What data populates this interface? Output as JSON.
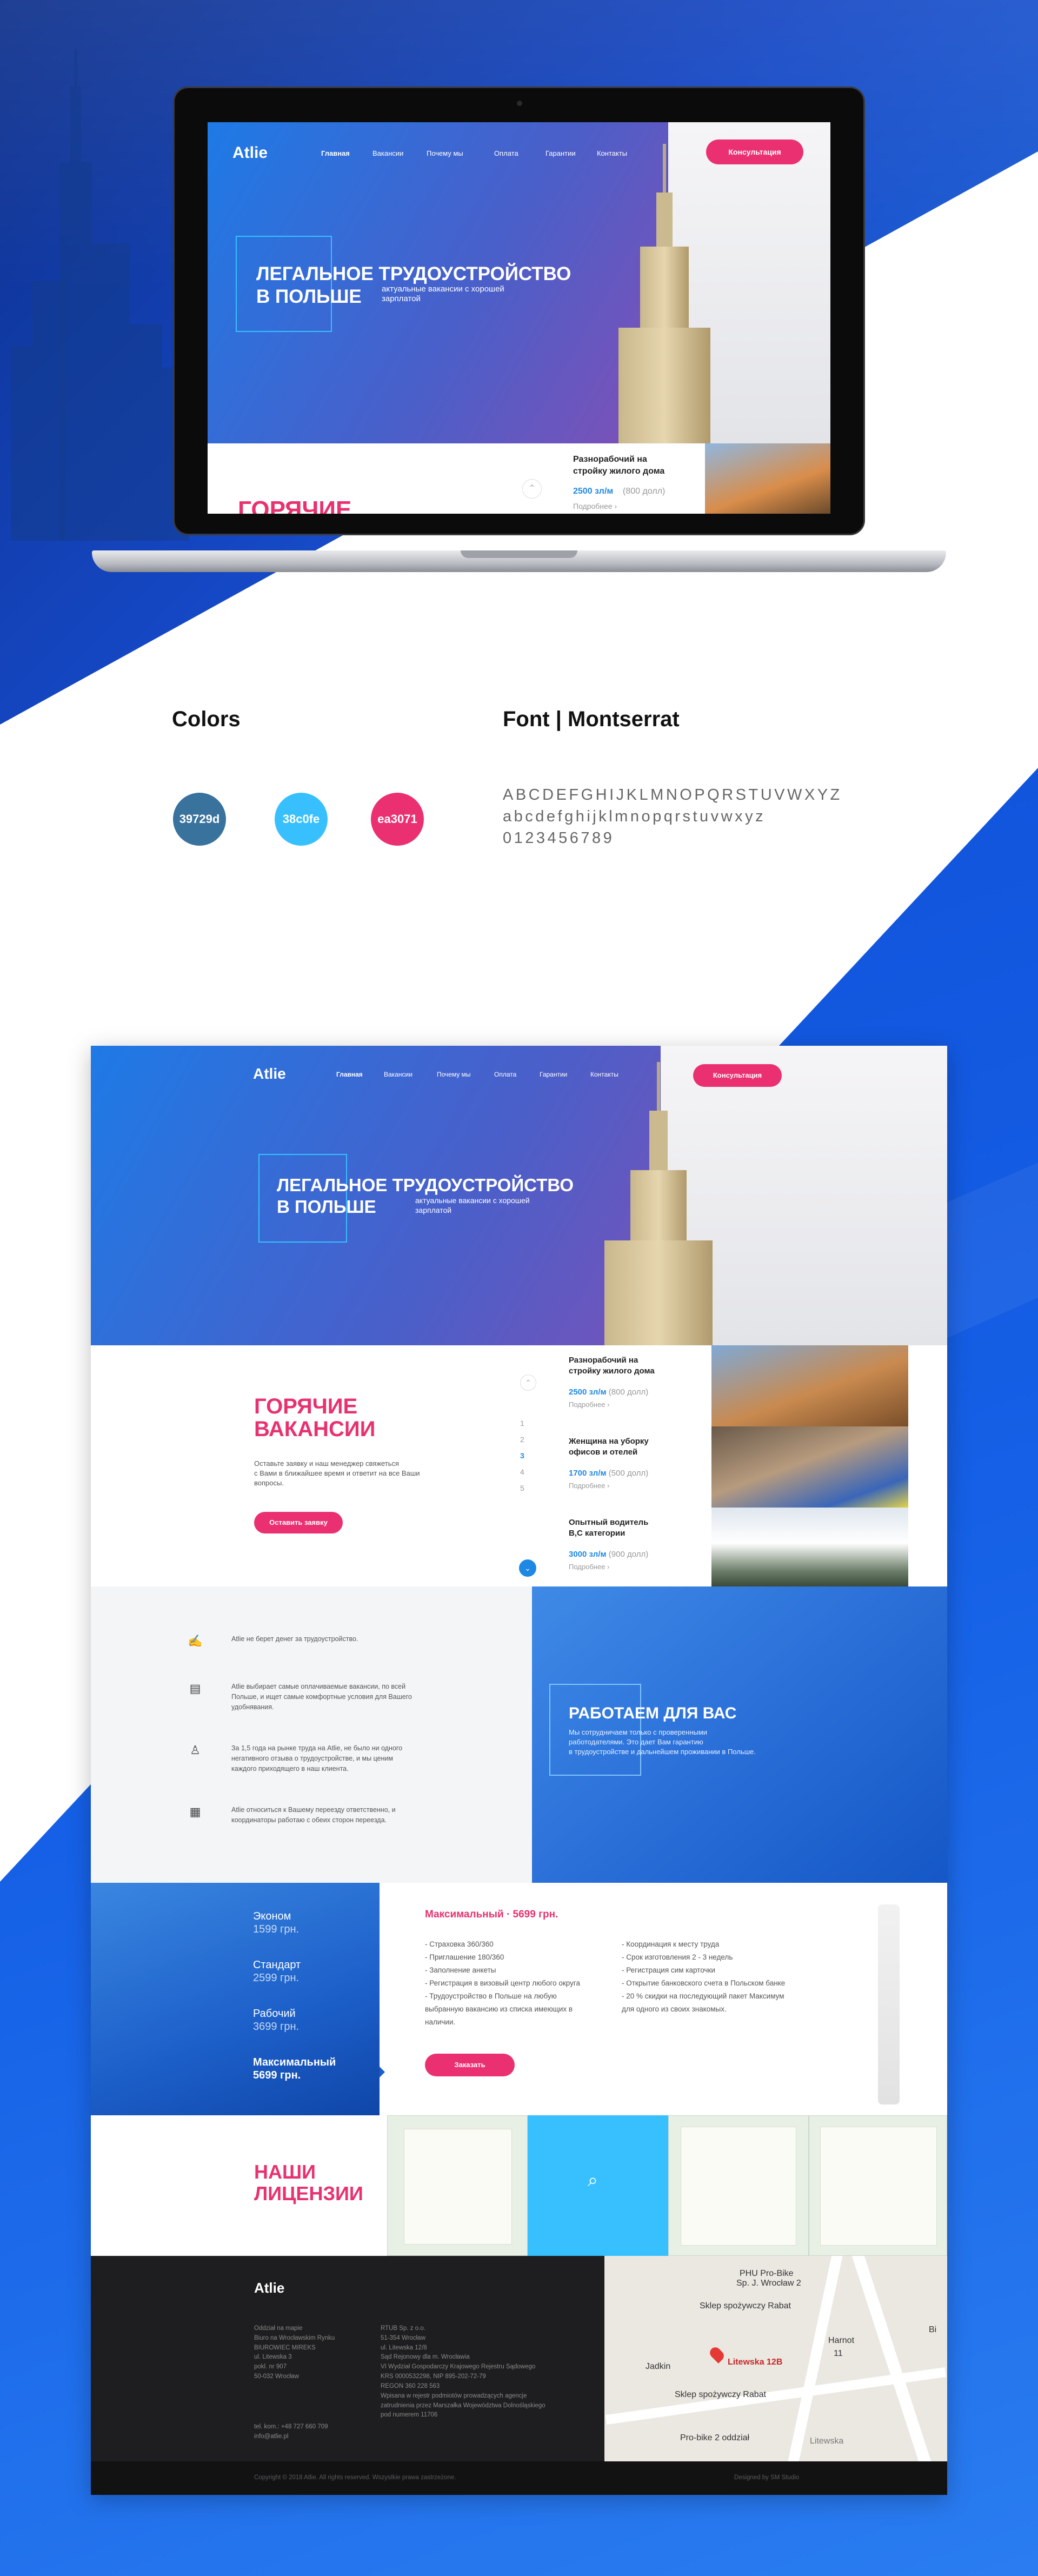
{
  "colors": {
    "primary": "#39729d",
    "accent": "#38c0fe",
    "pink": "#ea3071"
  },
  "site": {
    "logo": "Atlie",
    "nav": [
      "Главная",
      "Вакансии",
      "Почему мы",
      "Оплата",
      "Гарантии",
      "Контакты"
    ],
    "consult_btn": "Консультация",
    "hero_title_1": "ЛЕГАЛЬНОЕ ТРУДОУСТРОЙСТВО",
    "hero_title_2": "В ПОЛЬШЕ",
    "hero_sub_1": "актуальные вакансии с хорошей",
    "hero_sub_2": "зарплатой"
  },
  "jobs": {
    "title_1": "ГОРЯЧИЕ",
    "title_2": "ВАКАНСИИ",
    "desc_1": "Оставьте заявку и наш менеджер свяжеться",
    "desc_2": "с Вами в ближайшее время и ответит на все Ваши",
    "desc_3": "вопросы.",
    "button": "Оставить заявку",
    "pager": [
      "1",
      "2",
      "3",
      "4",
      "5"
    ],
    "items": [
      {
        "title_1": "Разнорабочий на",
        "title_2": "стройку жилого дома",
        "price": "2500 зл/м",
        "old": "(800 долл)",
        "more": "Подробнее ›"
      },
      {
        "title_1": "Женщина на уборку",
        "title_2": "офисов и отелей",
        "price": "1700 зл/м",
        "old": "(500 долл)",
        "more": "Подробнее ›"
      },
      {
        "title_1": "Опытный водитель",
        "title_2": "B,C категории",
        "price": "3000 зл/м",
        "old": "(900 долл)",
        "more": "Подробнее ›"
      }
    ],
    "laptop_short": "ГОРЯЧИЕ"
  },
  "style_guide": {
    "colors_title": "Colors",
    "font_title": "Font | Montserrat",
    "swatches": [
      "39729d",
      "38c0fe",
      "ea3071"
    ],
    "upper": "ABCDEFGHIJKLMNOPQRSTUVWXYZ",
    "lower": "abcdefghijklmnopqrstuvwxyz",
    "digits": "0123456789"
  },
  "why": {
    "features": [
      {
        "icon": "handshake-icon",
        "line_1": "Atlie не берет денег за трудоустройство."
      },
      {
        "icon": "document-icon",
        "line_1": "Atlie выбирает самые оплачиваемые вакансии, по всей",
        "line_2": "Польше, и ищет самые комфортные условия для Вашего",
        "line_3": "удобнявания."
      },
      {
        "icon": "worker-icon",
        "line_1": "За 1,5 года на рынке труда на Atlie, не было ни одного",
        "line_2": "негативного отзыва о трудоустройстве, и мы ценим",
        "line_3": "каждого приходящего в наш клиента."
      },
      {
        "icon": "contract-icon",
        "line_1": "Atlie относиться к Вашему переезду ответственно, и",
        "line_2": "координаторы работаю с обеих сторон переезда."
      }
    ],
    "title": "РАБОТАЕМ ДЛЯ ВАС",
    "text_1": "Мы сотрудничаем только с проверенными",
    "text_2": "работодателями. Это дает Вам гарантию",
    "text_3": "в трудоустройстве и дальнейшем проживании в Польше."
  },
  "pricing": {
    "plans": [
      {
        "name": "Эконом",
        "price": "1599 грн."
      },
      {
        "name": "Стандарт",
        "price": "2599 грн."
      },
      {
        "name": "Рабочий",
        "price": "3699 грн."
      },
      {
        "name": "Максимальный",
        "price": "5699 грн."
      }
    ],
    "selected_name": "Максимальный",
    "selected_price": "5699 грн.",
    "left_list": [
      "- Страховка 360/360",
      "- Приглашение 180/360",
      "- Заполнение анкеты",
      "- Регистрация в визовый центр любого округа",
      "- Трудоустройство в Польше на любую",
      "выбранную вакансию из списка имеющих в",
      "наличии."
    ],
    "right_list": [
      "- Координация к месту труда",
      "- Срок изготовления 2 - 3 недель",
      "- Регистрация сим карточки",
      "- Открытие банковского счета в Польском банке",
      "- 20 % скидки на последующий пакет Максимум",
      "для одного из своих знакомых."
    ],
    "order_btn": "Заказать"
  },
  "licenses": {
    "title_1": "НАШИ",
    "title_2": "ЛИЦЕНЗИИ"
  },
  "footer": {
    "logo": "Atlie",
    "col1": [
      "Oddział na mapie",
      "Biuro na Wrocławskim Rynku",
      "BIUROWIEC MIREKS",
      "ul. Litewska 3",
      "pokl. nr 907",
      "50-032 Wrocław"
    ],
    "col2": [
      "RTUB Sp. z o.o.",
      "51-354 Wrocław",
      "ul. Litewska 12/8",
      "Sąd Rejonowy dla m. Wrocławia",
      "VI Wydział Gospodarczy Krajowego Rejestru Sądowego",
      "KRS 0000532298, NIP 895-202-72-79",
      "REGON 360 228 563",
      "Wpisana w rejestr podmiotów prowadzących agencje",
      "zatrudnienia przez Marszałka Województwa Dolnośląskiego",
      "pod numerem 11706"
    ],
    "phone": "tel. kom.: +48 727 660 709",
    "email": "info@atlie.pl",
    "copyright": "Copyright © 2018 Atlie. All rights reserved. Wszystkie prawa zastrzeżone.",
    "credit": "Designed by SM Studio"
  },
  "map": {
    "labels": [
      "PHU Pro-Bike",
      "Sp. J. Wrocław 2",
      "Sklep spożywczy Rabat",
      "Jadkin",
      "Litewska 12B",
      "Sklep spożywczy Rabat",
      "Pro-bike 2 oddział",
      "Litewska",
      "Harnot",
      "11",
      "Bi"
    ]
  }
}
